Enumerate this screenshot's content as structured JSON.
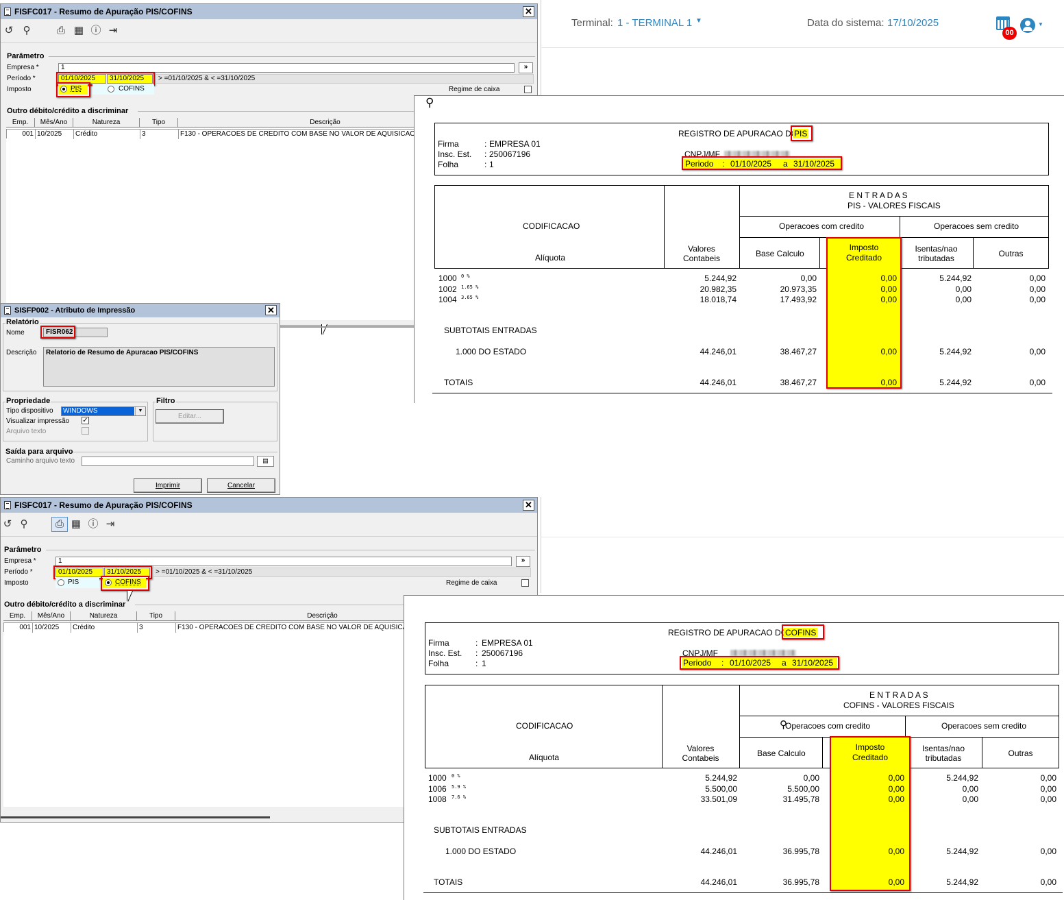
{
  "window1": {
    "title": "FISFC017 - Resumo de Apuração PIS/COFINS",
    "params": {
      "group_title": "Parâmetro",
      "empresa_label": "Empresa *",
      "empresa_value": "1",
      "empresa_btn": "»",
      "periodo_label": "Período *",
      "periodo_start": "01/10/2025",
      "periodo_end": "31/10/2025",
      "periodo_expr": "> =01/10/2025 & < =31/10/2025",
      "imposto_label": "Imposto",
      "pis_label": "PIS",
      "cofins_label": "COFINS",
      "regime_label": "Regime de caixa"
    },
    "grid": {
      "group_title": "Outro débito/crédito a discriminar",
      "headers": [
        "Emp.",
        "Mês/Ano",
        "Natureza",
        "Tipo",
        "Descrição"
      ],
      "row": [
        "001",
        "10/2025",
        "Crédito",
        "3",
        "F130 - OPERACOES DE CREDITO COM BASE NO VALOR DE AQUISICAO"
      ]
    }
  },
  "topbar": {
    "terminal_label": "Terminal:",
    "terminal_value": "1 - TERMINAL 1",
    "date_label": "Data do sistema:",
    "date_value": "17/10/2025",
    "badge": "00"
  },
  "dialog": {
    "title": "SISFP002 - Atributo de Impressão",
    "relatorio_group": "Relatório",
    "nome_label": "Nome",
    "nome_value": "FISR062",
    "descricao_label": "Descrição",
    "descricao_value": "Relatorio de Resumo de Apuracao PIS/COFINS",
    "propriedade_group": "Propriedade",
    "tipo_label": "Tipo dispositivo",
    "tipo_value": "WINDOWS",
    "visualizar_label": "Visualizar impressão",
    "arquivo_label": "Arquivo texto",
    "filtro_group": "Filtro",
    "editar_btn": "Editar...",
    "saida_group": "Saída para arquivo",
    "caminho_label": "Caminho arquivo texto",
    "imprimir_btn": "Imprimir",
    "cancelar_btn": "Cancelar"
  },
  "window2": {
    "title": "FISFC017 - Resumo de Apuração PIS/COFINS",
    "params": {
      "group_title": "Parâmetro",
      "empresa_label": "Empresa *",
      "empresa_value": "1",
      "empresa_btn": "»",
      "periodo_label": "Período *",
      "periodo_start": "01/10/2025",
      "periodo_end": "31/10/2025",
      "periodo_expr": "> =01/10/2025 & < =31/10/2025",
      "imposto_label": "Imposto",
      "pis_label": "PIS",
      "cofins_label": "COFINS",
      "regime_label": "Regime de caixa"
    },
    "grid": {
      "group_title": "Outro débito/crédito a discriminar",
      "headers": [
        "Emp.",
        "Mês/Ano",
        "Natureza",
        "Tipo",
        "Descrição"
      ],
      "row": [
        "001",
        "10/2025",
        "Crédito",
        "3",
        "F130 - OPERACOES DE CREDITO COM BASE NO VALOR DE AQUISICAO"
      ]
    }
  },
  "report_pis": {
    "title_prefix": "REGISTRO DE APURACAO DO",
    "imposto": "PIS",
    "firma_label": "Firma",
    "firma_value": "EMPRESA 01",
    "insc_label": "Insc. Est.",
    "insc_value": "250067196",
    "folha_label": "Folha",
    "folha_value": "1",
    "cnpj_label": "CNPJ/MF",
    "colon": ":",
    "periodo_label": "Periodo",
    "periodo_start": "01/10/2025",
    "periodo_a": "a",
    "periodo_end": "31/10/2025",
    "entradas": "E N T R A D A S",
    "valores_fiscais": "PIS  -  VALORES FISCAIS",
    "codificacao": "CODIFICACAO",
    "aliquota": "Alíquota",
    "valores_contabeis_1": "Valores",
    "valores_contabeis_2": "Contabeis",
    "op_com_credito": "Operacoes com credito",
    "op_sem_credito": "Operacoes sem credito",
    "base_calculo": "Base Calculo",
    "imposto_creditado_1": "Imposto",
    "imposto_creditado_2": "Creditado",
    "isentas_1": "Isentas/nao",
    "isentas_2": "tributadas",
    "outras": "Outras",
    "rows": [
      {
        "cod": "1000",
        "aliq": "0 %",
        "valores": "5.244,92",
        "base": "0,00",
        "imposto": "0,00",
        "isentas": "5.244,92",
        "outras": "0,00"
      },
      {
        "cod": "1002",
        "aliq": "1.65 %",
        "valores": "20.982,35",
        "base": "20.973,35",
        "imposto": "0,00",
        "isentas": "0,00",
        "outras": "0,00"
      },
      {
        "cod": "1004",
        "aliq": "3.65 %",
        "valores": "18.018,74",
        "base": "17.493,92",
        "imposto": "0,00",
        "isentas": "0,00",
        "outras": "0,00"
      }
    ],
    "subtotais_label": "SUBTOTAIS ENTRADAS",
    "estado": {
      "label": "1.000  DO ESTADO",
      "valores": "44.246,01",
      "base": "38.467,27",
      "imposto": "0,00",
      "isentas": "5.244,92",
      "outras": "0,00"
    },
    "totais": {
      "label": "TOTAIS",
      "valores": "44.246,01",
      "base": "38.467,27",
      "imposto": "0,00",
      "isentas": "5.244,92",
      "outras": "0,00"
    }
  },
  "report_cofins": {
    "title_prefix": "REGISTRO DE APURACAO DO",
    "imposto": "COFINS",
    "firma_label": "Firma",
    "firma_value": "EMPRESA 01",
    "insc_label": "Insc. Est.",
    "insc_value": "250067196",
    "folha_label": "Folha",
    "folha_value": "1",
    "cnpj_label": "CNPJ/MF",
    "colon": ":",
    "periodo_label": "Periodo",
    "periodo_start": "01/10/2025",
    "periodo_a": "a",
    "periodo_end": "31/10/2025",
    "entradas": "E N T R A D A S",
    "valores_fiscais": "COFINS  -  VALORES FISCAIS",
    "codificacao": "CODIFICACAO",
    "aliquota": "Alíquota",
    "valores_contabeis_1": "Valores",
    "valores_contabeis_2": "Contabeis",
    "op_com_credito": "Operacoes com credito",
    "op_sem_credito": "Operacoes sem credito",
    "base_calculo": "Base Calculo",
    "imposto_creditado_1": "Imposto",
    "imposto_creditado_2": "Creditado",
    "isentas_1": "Isentas/nao",
    "isentas_2": "tributadas",
    "outras": "Outras",
    "rows": [
      {
        "cod": "1000",
        "aliq": "0 %",
        "valores": "5.244,92",
        "base": "0,00",
        "imposto": "0,00",
        "isentas": "5.244,92",
        "outras": "0,00"
      },
      {
        "cod": "1006",
        "aliq": "5.9 %",
        "valores": "5.500,00",
        "base": "5.500,00",
        "imposto": "0,00",
        "isentas": "0,00",
        "outras": "0,00"
      },
      {
        "cod": "1008",
        "aliq": "7.6 %",
        "valores": "33.501,09",
        "base": "31.495,78",
        "imposto": "0,00",
        "isentas": "0,00",
        "outras": "0,00"
      }
    ],
    "subtotais_label": "SUBTOTAIS ENTRADAS",
    "estado": {
      "label": "1.000  DO ESTADO",
      "valores": "44.246,01",
      "base": "36.995,78",
      "imposto": "0,00",
      "isentas": "5.244,92",
      "outras": "0,00"
    },
    "totais": {
      "label": "TOTAIS",
      "valores": "44.246,01",
      "base": "36.995,78",
      "imposto": "0,00",
      "isentas": "5.244,92",
      "outras": "0,00"
    }
  },
  "colors": {
    "highlight": "#ffff00",
    "annotation_border": "#e00000",
    "accent": "#2e86c1",
    "titlebar": "#b3c3d9"
  }
}
